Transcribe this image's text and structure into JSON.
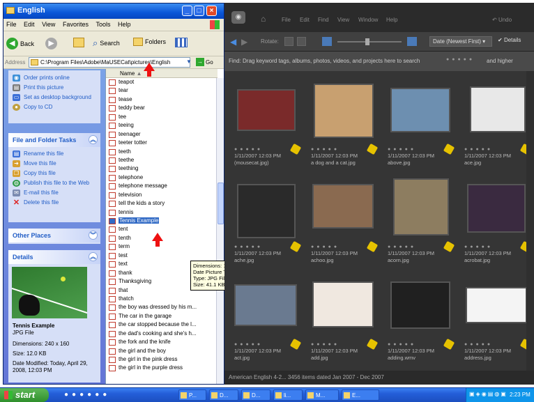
{
  "explorer": {
    "title": "English",
    "menu": [
      "File",
      "Edit",
      "View",
      "Favorites",
      "Tools",
      "Help"
    ],
    "toolbar": {
      "back": "Back",
      "search": "Search",
      "folders": "Folders"
    },
    "address": {
      "label": "Address",
      "value": "C:\\Program Files\\Adobe\\MaUSECat\\pictures\\English",
      "go": "Go"
    },
    "picture_tasks": [
      "Order prints online",
      "Print this picture",
      "Set as desktop background",
      "Copy to CD"
    ],
    "file_tasks": {
      "title": "File and Folder Tasks",
      "items": [
        "Rename this file",
        "Move this file",
        "Copy this file",
        "Publish this file to the Web",
        "E-mail this file",
        "Delete this file"
      ]
    },
    "other_places": {
      "title": "Other Places"
    },
    "details": {
      "title": "Details",
      "name": "Tennis Example",
      "type": "JPG File",
      "dimensions": "Dimensions: 240 x 160",
      "size": "Size: 12.0 KB",
      "modified": "Date Modified: Today, April 29, 2008, 12:03 PM"
    },
    "column_header": "Name",
    "files": [
      "teapot",
      "tear",
      "tease",
      "teddy bear",
      "tee",
      "teeing",
      "teenager",
      "teeter totter",
      "teeth",
      "teethe",
      "teething",
      "telephone",
      "telephone message",
      "television",
      "tell the kids a story",
      "tennis",
      "Tennis Example",
      "tent",
      "tenth",
      "term",
      "test",
      "text",
      "thank",
      "Thanksgiving",
      "that",
      "thatch",
      "the boy was dressed by his m...",
      "The car in the garage",
      "the car stopped because the l...",
      "the dad's cooking and she's h...",
      "the fork and the knife",
      "the girl and the boy",
      "the girl in the pink dress",
      "the girl in the purple dress"
    ],
    "selected_index": 16,
    "tooltip": [
      "Dimensions: 1024 x 768",
      "Date Picture Taken: 1/11/2007 12:03 PM",
      "Type: JPG File",
      "Size: 41.1 KB"
    ]
  },
  "organizer": {
    "menu": [
      "File",
      "Edit",
      "Find",
      "View",
      "Window",
      "Help"
    ],
    "undo": "Undo",
    "rotate": "Rotate:",
    "sort": "Date (Newest First)",
    "details": "Details",
    "findbar": "Find: Drag keyword tags, albums, photos, videos, and projects here to search",
    "rating_filter": "and higher",
    "status": "American English 4-2...   3456 items dated Jan 2007 - Dec 2007",
    "thumbs": [
      {
        "date": "1/11/2007 12:03 PM",
        "name": "(mousecat.jpg)",
        "color": "#7a2a2a"
      },
      {
        "date": "1/11/2007 12:03 PM",
        "name": "a dog and a cat.jpg",
        "color": "#c8a070"
      },
      {
        "date": "1/11/2007 12:03 PM",
        "name": "above.jpg",
        "color": "#6d8fb0"
      },
      {
        "date": "1/11/2007 12:03 PM",
        "name": "ace.jpg",
        "color": "#e8e8e8"
      },
      {
        "date": "1/11/2007 12:03 PM",
        "name": "ache.jpg",
        "color": "#2a2a2a"
      },
      {
        "date": "1/11/2007 12:03 PM",
        "name": "achoo.jpg",
        "color": "#8a6a50"
      },
      {
        "date": "1/11/2007 12:03 PM",
        "name": "acorn.jpg",
        "color": "#8d7d60"
      },
      {
        "date": "1/11/2007 12:03 PM",
        "name": "acrobat.jpg",
        "color": "#3a2a40"
      },
      {
        "date": "1/11/2007 12:03 PM",
        "name": "act.jpg",
        "color": "#6a7a90"
      },
      {
        "date": "1/11/2007 12:03 PM",
        "name": "add.jpg",
        "color": "#f0e8e0"
      },
      {
        "date": "1/11/2007 12:03 PM",
        "name": "adding.wmv",
        "color": "#202020"
      },
      {
        "date": "1/11/2007 12:03 PM",
        "name": "address.jpg",
        "color": "#f4f4f4"
      }
    ]
  },
  "taskbar": {
    "start": "start",
    "buttons": [
      "P...",
      "D...",
      "D...",
      "li...",
      "M...",
      "E..."
    ],
    "clock": "2:23 PM"
  },
  "colors": {
    "xp_blue": "#0a56d8",
    "panel_text": "#215dc6",
    "organizer_bg": "#353535",
    "selection": "#316ac5",
    "arrow": "#e11111"
  }
}
